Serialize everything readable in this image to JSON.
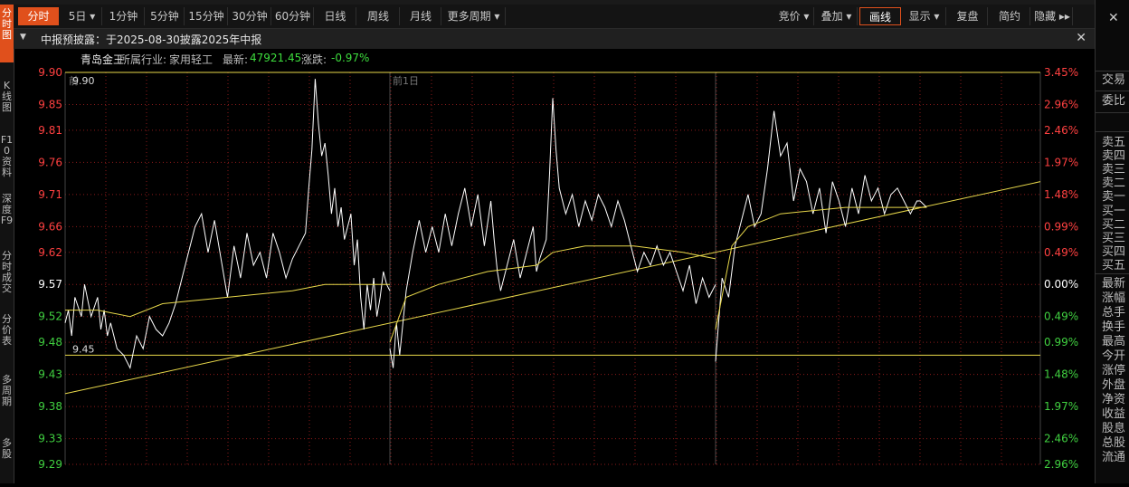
{
  "left_tabs": [
    {
      "label": "分时图",
      "active": true
    },
    {
      "label": "K线图",
      "active": false
    },
    {
      "label": "F10资料",
      "active": false
    },
    {
      "label": "深度F9",
      "active": false
    },
    {
      "label": "分时成交",
      "active": false
    },
    {
      "label": "分价表",
      "active": false
    },
    {
      "label": "多周期",
      "active": false
    },
    {
      "label": "多股",
      "active": false
    }
  ],
  "toolbar": {
    "left": [
      {
        "label": "分时",
        "active": true
      },
      {
        "label": "5日 ▾",
        "active": false
      },
      {
        "label": "1分钟",
        "active": false
      },
      {
        "label": "5分钟",
        "active": false
      },
      {
        "label": "15分钟",
        "active": false
      },
      {
        "label": "30分钟",
        "active": false
      },
      {
        "label": "60分钟",
        "active": false
      },
      {
        "label": "日线",
        "active": false
      },
      {
        "label": "周线",
        "active": false
      },
      {
        "label": "月线",
        "active": false
      },
      {
        "label": "更多周期 ▾",
        "active": false
      }
    ],
    "right": [
      {
        "label": "竞价 ▾",
        "active": false
      },
      {
        "label": "叠加 ▾",
        "active": false
      },
      {
        "label": "画线",
        "active": true
      },
      {
        "label": "显示 ▾",
        "active": false
      },
      {
        "label": "复盘",
        "active": false
      },
      {
        "label": "简约",
        "active": false
      },
      {
        "label": "隐藏 ▸▸",
        "active": false
      }
    ]
  },
  "notice": {
    "text": "中报预披露：于2025-08-30披露2025年中报"
  },
  "stock": {
    "name": "青岛金王",
    "industry_label": "所属行业:",
    "industry": "家用轻工",
    "latest_label": "最新:",
    "latest": "47921.45",
    "change_label": "涨跌:",
    "change": "-0.97%"
  },
  "chart_data": {
    "type": "line",
    "title": "",
    "y_ticks": [
      "9.90",
      "9.85",
      "9.81",
      "9.76",
      "9.71",
      "9.66",
      "9.62",
      "9.57",
      "9.52",
      "9.48",
      "9.43",
      "9.38",
      "9.33",
      "9.29"
    ],
    "pct_ticks": [
      "3.45%",
      "2.96%",
      "2.46%",
      "1.97%",
      "1.48%",
      "0.99%",
      "0.49%",
      "0.00%",
      "0.49%",
      "0.99%",
      "1.48%",
      "1.97%",
      "2.46%",
      "2.96%"
    ],
    "ylim": [
      9.29,
      9.9
    ],
    "prev_close": 9.57,
    "day_labels": [
      "前",
      "前1日"
    ],
    "max_marker": "9.90",
    "min_marker": "9.45",
    "hlines": [
      9.9,
      9.46
    ],
    "trendline": {
      "start": 9.4,
      "end": 9.73
    },
    "days": [
      {
        "price": [
          [
            0,
            9.51
          ],
          [
            0.01,
            9.53
          ],
          [
            0.02,
            9.49
          ],
          [
            0.03,
            9.55
          ],
          [
            0.05,
            9.52
          ],
          [
            0.06,
            9.57
          ],
          [
            0.08,
            9.52
          ],
          [
            0.1,
            9.55
          ],
          [
            0.11,
            9.5
          ],
          [
            0.12,
            9.53
          ],
          [
            0.13,
            9.49
          ],
          [
            0.14,
            9.51
          ],
          [
            0.16,
            9.47
          ],
          [
            0.18,
            9.46
          ],
          [
            0.2,
            9.44
          ],
          [
            0.22,
            9.49
          ],
          [
            0.24,
            9.47
          ],
          [
            0.26,
            9.52
          ],
          [
            0.28,
            9.5
          ],
          [
            0.3,
            9.49
          ],
          [
            0.32,
            9.51
          ],
          [
            0.34,
            9.54
          ],
          [
            0.36,
            9.58
          ],
          [
            0.38,
            9.62
          ],
          [
            0.4,
            9.66
          ],
          [
            0.42,
            9.68
          ],
          [
            0.44,
            9.62
          ],
          [
            0.46,
            9.67
          ],
          [
            0.48,
            9.61
          ],
          [
            0.5,
            9.55
          ],
          [
            0.52,
            9.63
          ],
          [
            0.54,
            9.58
          ],
          [
            0.56,
            9.65
          ],
          [
            0.58,
            9.6
          ],
          [
            0.6,
            9.62
          ],
          [
            0.62,
            9.58
          ],
          [
            0.64,
            9.65
          ],
          [
            0.66,
            9.62
          ],
          [
            0.68,
            9.58
          ],
          [
            0.7,
            9.61
          ],
          [
            0.72,
            9.63
          ],
          [
            0.74,
            9.65
          ],
          [
            0.75,
            9.72
          ],
          [
            0.76,
            9.78
          ],
          [
            0.77,
            9.89
          ],
          [
            0.78,
            9.82
          ],
          [
            0.79,
            9.77
          ],
          [
            0.8,
            9.79
          ],
          [
            0.81,
            9.74
          ],
          [
            0.82,
            9.68
          ],
          [
            0.83,
            9.72
          ],
          [
            0.84,
            9.66
          ],
          [
            0.85,
            9.69
          ],
          [
            0.86,
            9.64
          ],
          [
            0.88,
            9.68
          ],
          [
            0.89,
            9.6
          ],
          [
            0.9,
            9.64
          ],
          [
            0.91,
            9.55
          ],
          [
            0.92,
            9.5
          ],
          [
            0.93,
            9.57
          ],
          [
            0.94,
            9.53
          ],
          [
            0.95,
            9.58
          ],
          [
            0.96,
            9.52
          ],
          [
            0.97,
            9.55
          ],
          [
            0.98,
            9.59
          ],
          [
            0.99,
            9.57
          ],
          [
            1,
            9.56
          ]
        ],
        "avg": [
          [
            0,
            9.53
          ],
          [
            0.1,
            9.53
          ],
          [
            0.2,
            9.52
          ],
          [
            0.3,
            9.54
          ],
          [
            0.5,
            9.55
          ],
          [
            0.7,
            9.56
          ],
          [
            0.8,
            9.57
          ],
          [
            1,
            9.57
          ]
        ]
      },
      {
        "price": [
          [
            0,
            9.47
          ],
          [
            0.01,
            9.44
          ],
          [
            0.02,
            9.51
          ],
          [
            0.03,
            9.46
          ],
          [
            0.05,
            9.56
          ],
          [
            0.07,
            9.62
          ],
          [
            0.09,
            9.67
          ],
          [
            0.11,
            9.62
          ],
          [
            0.13,
            9.66
          ],
          [
            0.15,
            9.62
          ],
          [
            0.17,
            9.68
          ],
          [
            0.19,
            9.63
          ],
          [
            0.21,
            9.68
          ],
          [
            0.23,
            9.72
          ],
          [
            0.25,
            9.66
          ],
          [
            0.27,
            9.71
          ],
          [
            0.29,
            9.63
          ],
          [
            0.31,
            9.7
          ],
          [
            0.32,
            9.64
          ],
          [
            0.33,
            9.59
          ],
          [
            0.34,
            9.56
          ],
          [
            0.36,
            9.6
          ],
          [
            0.38,
            9.64
          ],
          [
            0.4,
            9.58
          ],
          [
            0.42,
            9.62
          ],
          [
            0.44,
            9.66
          ],
          [
            0.45,
            9.59
          ],
          [
            0.46,
            9.61
          ],
          [
            0.48,
            9.64
          ],
          [
            0.49,
            9.74
          ],
          [
            0.5,
            9.86
          ],
          [
            0.51,
            9.78
          ],
          [
            0.52,
            9.72
          ],
          [
            0.54,
            9.68
          ],
          [
            0.56,
            9.71
          ],
          [
            0.58,
            9.66
          ],
          [
            0.6,
            9.7
          ],
          [
            0.62,
            9.67
          ],
          [
            0.64,
            9.71
          ],
          [
            0.66,
            9.69
          ],
          [
            0.68,
            9.66
          ],
          [
            0.7,
            9.7
          ],
          [
            0.72,
            9.67
          ],
          [
            0.74,
            9.63
          ],
          [
            0.76,
            9.59
          ],
          [
            0.78,
            9.62
          ],
          [
            0.8,
            9.6
          ],
          [
            0.82,
            9.63
          ],
          [
            0.84,
            9.6
          ],
          [
            0.86,
            9.62
          ],
          [
            0.88,
            9.59
          ],
          [
            0.9,
            9.56
          ],
          [
            0.92,
            9.6
          ],
          [
            0.94,
            9.54
          ],
          [
            0.96,
            9.58
          ],
          [
            0.98,
            9.55
          ],
          [
            1,
            9.57
          ]
        ],
        "avg": [
          [
            0,
            9.48
          ],
          [
            0.05,
            9.55
          ],
          [
            0.15,
            9.57
          ],
          [
            0.3,
            9.59
          ],
          [
            0.45,
            9.6
          ],
          [
            0.5,
            9.62
          ],
          [
            0.6,
            9.63
          ],
          [
            0.75,
            9.63
          ],
          [
            0.9,
            9.62
          ],
          [
            1,
            9.61
          ]
        ]
      },
      {
        "price": [
          [
            0,
            9.45
          ],
          [
            0.02,
            9.58
          ],
          [
            0.04,
            9.55
          ],
          [
            0.06,
            9.63
          ],
          [
            0.08,
            9.67
          ],
          [
            0.1,
            9.71
          ],
          [
            0.12,
            9.66
          ],
          [
            0.14,
            9.68
          ],
          [
            0.16,
            9.75
          ],
          [
            0.18,
            9.84
          ],
          [
            0.2,
            9.77
          ],
          [
            0.22,
            9.79
          ],
          [
            0.24,
            9.7
          ],
          [
            0.26,
            9.75
          ],
          [
            0.28,
            9.73
          ],
          [
            0.3,
            9.68
          ],
          [
            0.32,
            9.72
          ],
          [
            0.34,
            9.65
          ],
          [
            0.36,
            9.73
          ],
          [
            0.38,
            9.7
          ],
          [
            0.4,
            9.66
          ],
          [
            0.42,
            9.72
          ],
          [
            0.44,
            9.68
          ],
          [
            0.46,
            9.74
          ],
          [
            0.48,
            9.7
          ],
          [
            0.5,
            9.72
          ],
          [
            0.52,
            9.68
          ],
          [
            0.54,
            9.71
          ],
          [
            0.56,
            9.72
          ],
          [
            0.58,
            9.7
          ],
          [
            0.6,
            9.68
          ],
          [
            0.62,
            9.7
          ],
          [
            0.63,
            9.7
          ],
          [
            0.65,
            9.69
          ]
        ],
        "avg": [
          [
            0,
            9.5
          ],
          [
            0.05,
            9.63
          ],
          [
            0.1,
            9.66
          ],
          [
            0.2,
            9.68
          ],
          [
            0.4,
            9.69
          ],
          [
            0.65,
            9.69
          ]
        ]
      }
    ]
  },
  "right_panel": {
    "labels": [
      "交易",
      "委比",
      "卖五",
      "卖四",
      "卖三",
      "卖二",
      "卖一",
      "买一",
      "买二",
      "买三",
      "买四",
      "买五",
      "最新",
      "涨幅",
      "总手",
      "换手",
      "最高",
      "今开",
      "涨停",
      "外盘",
      "净资",
      "收益",
      "股息",
      "总股",
      "流通"
    ]
  },
  "colors": {
    "accent": "#e0501c",
    "axis_up": "#ff4040",
    "axis_down": "#40d040",
    "price": "#ffffff",
    "avg": "#e8d84a",
    "grid": "#8b1a1a"
  }
}
